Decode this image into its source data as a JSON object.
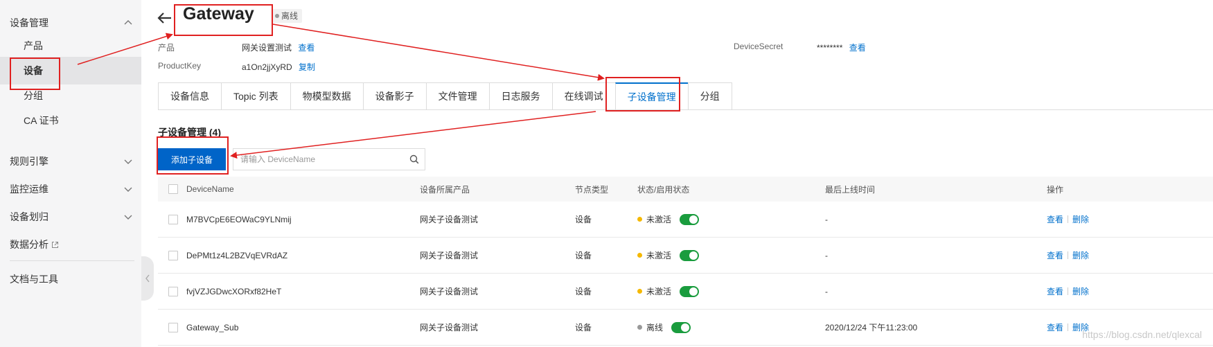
{
  "sidebar": {
    "groups": [
      {
        "label": "设备管理"
      },
      {
        "label": "规则引擎"
      },
      {
        "label": "监控运维"
      },
      {
        "label": "设备划归"
      },
      {
        "label": "数据分析"
      },
      {
        "label": "文档与工具"
      }
    ],
    "sub_items": [
      {
        "label": "产品"
      },
      {
        "label": "设备"
      },
      {
        "label": "分组"
      },
      {
        "label": "CA 证书"
      }
    ]
  },
  "header": {
    "title": "Gateway",
    "status": "离线"
  },
  "meta": {
    "product_label": "产品",
    "product_value": "网关设置测试",
    "product_link": "查看",
    "productkey_label": "ProductKey",
    "productkey_value": "a1On2jjXyRD",
    "productkey_link": "复制",
    "secret_label": "DeviceSecret",
    "secret_value": "********",
    "secret_link": "查看"
  },
  "tabs": [
    {
      "label": "设备信息"
    },
    {
      "label": "Topic 列表"
    },
    {
      "label": "物模型数据"
    },
    {
      "label": "设备影子"
    },
    {
      "label": "文件管理"
    },
    {
      "label": "日志服务"
    },
    {
      "label": "在线调试"
    },
    {
      "label": "子设备管理",
      "active": true
    },
    {
      "label": "分组"
    }
  ],
  "section": {
    "title": "子设备管理 (4)",
    "add_button": "添加子设备",
    "search_placeholder": "请输入 DeviceName"
  },
  "table": {
    "headers": {
      "name": "DeviceName",
      "product": "设备所属产品",
      "node": "节点类型",
      "status": "状态/启用状态",
      "time": "最后上线时间",
      "ops": "操作"
    },
    "rows": [
      {
        "name": "M7BVCpE6EOWaC9YLNmij",
        "product": "网关子设备测试",
        "node": "设备",
        "status": "未激活",
        "status_color": "#f5b800",
        "time": "-",
        "view": "查看",
        "delete": "删除"
      },
      {
        "name": "DePMt1z4L2BZVqEVRdAZ",
        "product": "网关子设备测试",
        "node": "设备",
        "status": "未激活",
        "status_color": "#f5b800",
        "time": "-",
        "view": "查看",
        "delete": "删除"
      },
      {
        "name": "fvjVZJGDwcXORxf82HeT",
        "product": "网关子设备测试",
        "node": "设备",
        "status": "未激活",
        "status_color": "#f5b800",
        "time": "-",
        "view": "查看",
        "delete": "删除"
      },
      {
        "name": "Gateway_Sub",
        "product": "网关子设备测试",
        "node": "设备",
        "status": "离线",
        "status_color": "#999999",
        "time": "2020/12/24 下午11:23:00",
        "view": "查看",
        "delete": "删除"
      }
    ]
  },
  "watermark": "https://blog.csdn.net/qlexcal",
  "colors": {
    "accent": "#0070cc",
    "primary_button": "#0064c8",
    "switch_on": "#1a9c3e",
    "annotation": "#e02020"
  }
}
